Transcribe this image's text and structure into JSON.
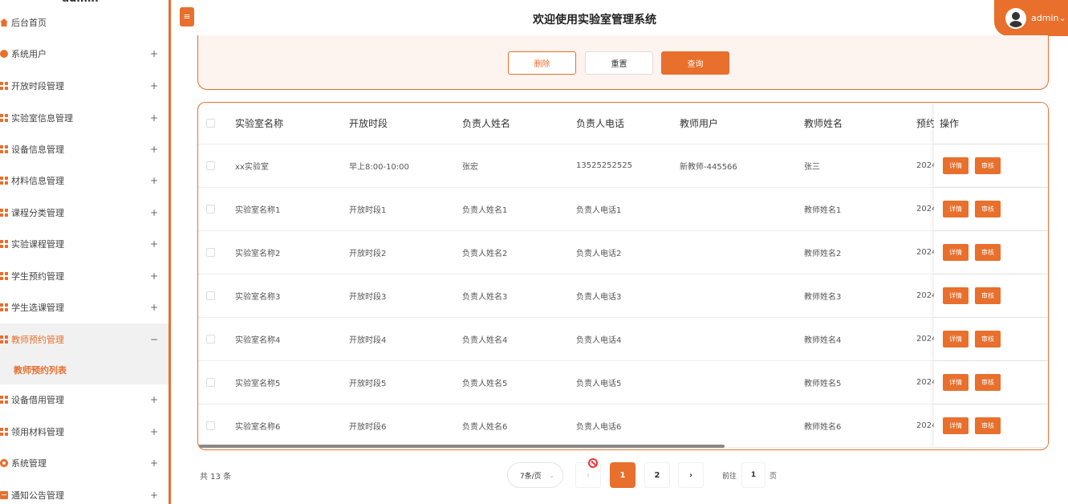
{
  "sidebar": {
    "username": "admin",
    "items": [
      {
        "label": "后台首页",
        "icon": "home-icon",
        "expand": ""
      },
      {
        "label": "系统用户",
        "icon": "user-icon",
        "expand": "+"
      },
      {
        "label": "开放时段管理",
        "icon": "grid-icon",
        "expand": "+"
      },
      {
        "label": "实验室信息管理",
        "icon": "grid-icon",
        "expand": "+"
      },
      {
        "label": "设备信息管理",
        "icon": "grid-icon",
        "expand": "+"
      },
      {
        "label": "材料信息管理",
        "icon": "grid-icon",
        "expand": "+"
      },
      {
        "label": "课程分类管理",
        "icon": "grid-icon",
        "expand": "+"
      },
      {
        "label": "实验课程管理",
        "icon": "grid-icon",
        "expand": "+"
      },
      {
        "label": "学生预约管理",
        "icon": "grid-icon",
        "expand": "+"
      },
      {
        "label": "学生选课管理",
        "icon": "grid-icon",
        "expand": "+"
      },
      {
        "label": "教师预约管理",
        "icon": "grid-icon",
        "expand": "−"
      },
      {
        "label": "设备借用管理",
        "icon": "grid-icon",
        "expand": "+"
      },
      {
        "label": "领用材料管理",
        "icon": "grid-icon",
        "expand": "+"
      },
      {
        "label": "系统管理",
        "icon": "gear-icon",
        "expand": "+"
      },
      {
        "label": "通知公告管理",
        "icon": "notice-icon",
        "expand": "+"
      }
    ],
    "submenu_label": "教师预约列表"
  },
  "header": {
    "toggle_icon": "≡",
    "title": "欢迎使用实验室管理系统",
    "user_name": "admin",
    "user_chevron": "⌄"
  },
  "search": {
    "delete_label": "删除",
    "reset_label": "重置",
    "query_label": "查询"
  },
  "table": {
    "columns": [
      "实验室名称",
      "开放时段",
      "负责人姓名",
      "负责人电话",
      "教师用户",
      "教师姓名",
      "预约",
      "操作"
    ],
    "rows": [
      [
        "xx实验室",
        "早上8:00-10:00",
        "张宏",
        "13525252525",
        "新教师-445566",
        "张三",
        "2024"
      ],
      [
        "实验室名称1",
        "开放时段1",
        "负责人姓名1",
        "负责人电话1",
        "",
        "教师姓名1",
        "2024"
      ],
      [
        "实验室名称2",
        "开放时段2",
        "负责人姓名2",
        "负责人电话2",
        "",
        "教师姓名2",
        "2024"
      ],
      [
        "实验室名称3",
        "开放时段3",
        "负责人姓名3",
        "负责人电话3",
        "",
        "教师姓名3",
        "2024"
      ],
      [
        "实验室名称4",
        "开放时段4",
        "负责人姓名4",
        "负责人电话4",
        "",
        "教师姓名4",
        "2024"
      ],
      [
        "实验室名称5",
        "开放时段5",
        "负责人姓名5",
        "负责人电话5",
        "",
        "教师姓名5",
        "2024"
      ],
      [
        "实验室名称6",
        "开放时段6",
        "负责人姓名6",
        "负责人电话6",
        "",
        "教师姓名6",
        "2024"
      ]
    ],
    "detail_label": "详情",
    "audit_label": "审核"
  },
  "pager": {
    "total": "共 13 条",
    "page_size": "7条/页",
    "page_size_chevron": "⌄",
    "prev": "‹",
    "page1": "1",
    "page2": "2",
    "next": "›",
    "goto_label": "前往",
    "goto_value": "1",
    "goto_suffix": "页"
  },
  "colors": {
    "accent": "#e86f2c",
    "panel_bg": "#fdf3ef"
  }
}
